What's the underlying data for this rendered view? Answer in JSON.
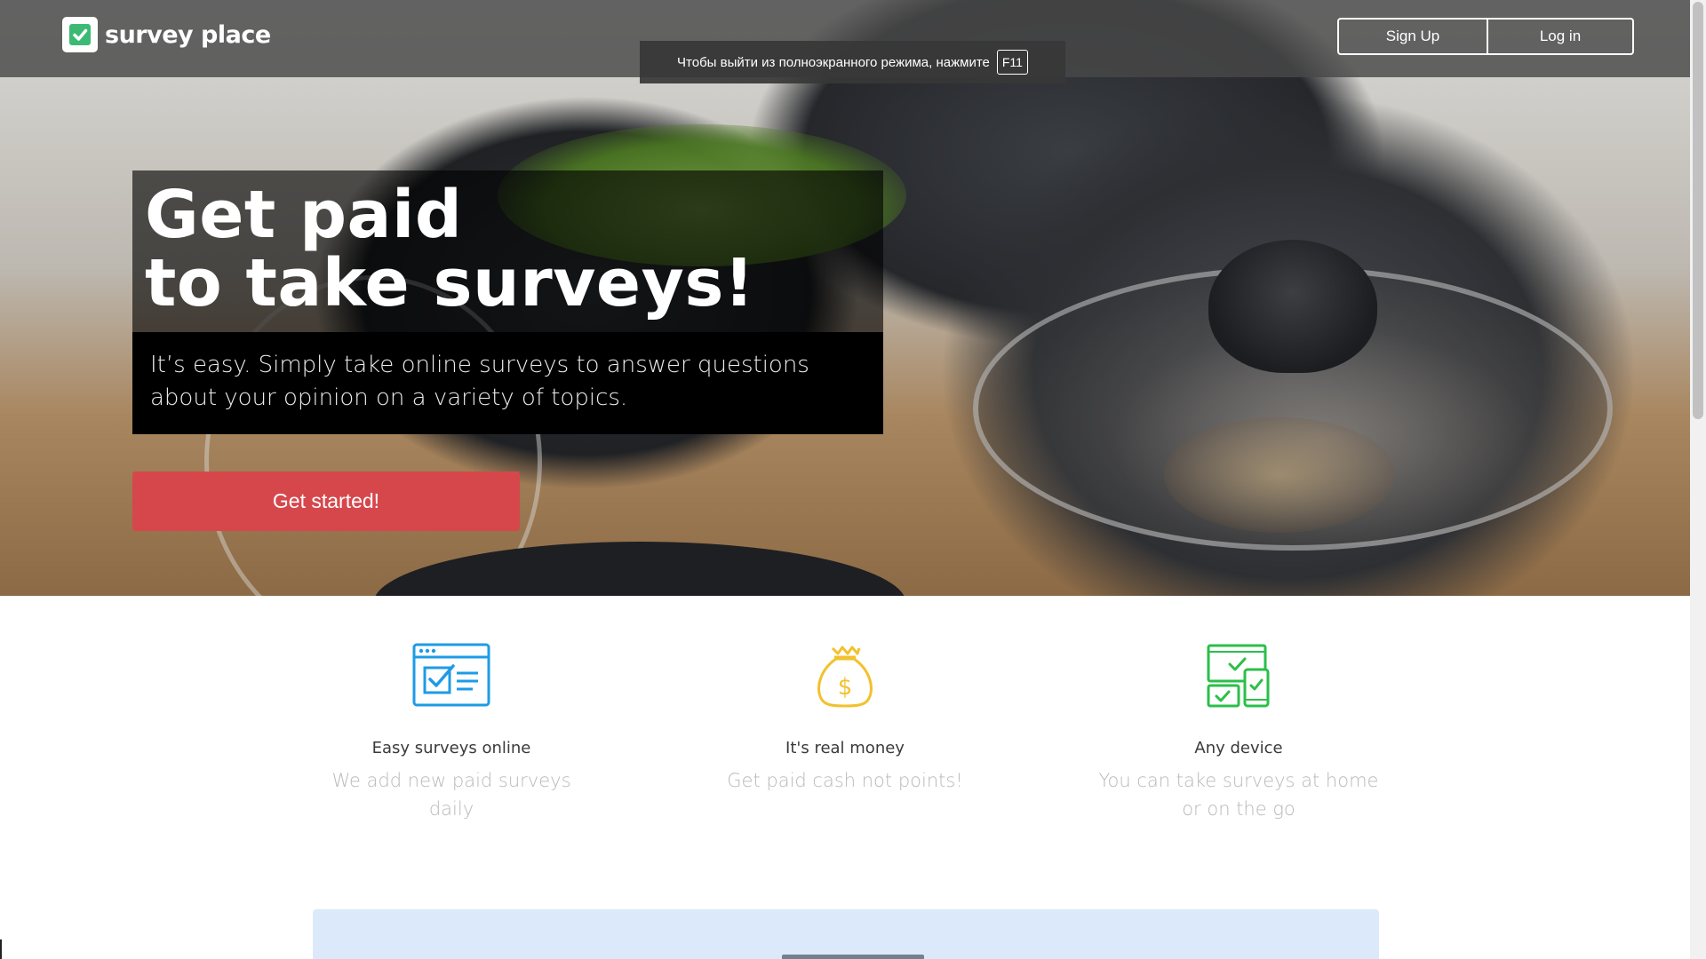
{
  "brand": {
    "name": "survey place",
    "check_color": "#3cba74"
  },
  "nav": {
    "signup_label": "Sign Up",
    "login_label": "Log in"
  },
  "fullscreen_notice": {
    "text": "Чтобы выйти из полноэкранного режима, нажмите",
    "key": "F11"
  },
  "hero": {
    "headline_line1": "Get paid",
    "headline_line2": "to take surveys!",
    "subtext": "It’s easy. Simply take online surveys to answer questions about your opinion on a variety of topics.",
    "cta_label": "Get started!",
    "cta_color": "#d6474c"
  },
  "features": [
    {
      "icon": "browser-checklist-icon",
      "icon_color": "#1e9be6",
      "title": "Easy surveys online",
      "description": "We add new paid surveys daily"
    },
    {
      "icon": "money-bag-icon",
      "icon_color": "#f2c12e",
      "title": "It's real money",
      "description": "Get paid cash not points!"
    },
    {
      "icon": "multi-device-icon",
      "icon_color": "#2bbf4a",
      "title": "Any device",
      "description": "You can take surveys at home or on the go"
    }
  ]
}
